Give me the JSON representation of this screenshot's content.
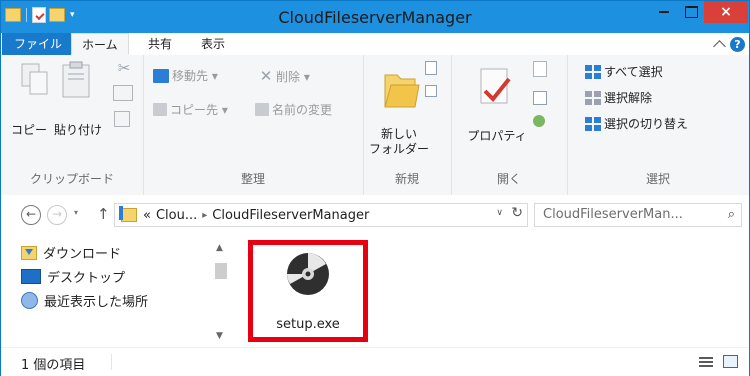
{
  "window": {
    "title": "CloudFileserverManager"
  },
  "titlebar": {
    "close": "×",
    "qat_dropdown": "▾"
  },
  "tabs": {
    "file": "ファイル",
    "home": "ホーム",
    "share": "共有",
    "view": "表示",
    "help": "?"
  },
  "ribbon": {
    "clipboard": {
      "copy": "コピー",
      "paste": "貼り付け",
      "label": "クリップボード"
    },
    "organize": {
      "move_to": "移動先 ▾",
      "delete": "削除 ▾",
      "copy_to": "コピー先 ▾",
      "rename": "名前の変更",
      "label": "整理"
    },
    "new": {
      "new_folder_line1": "新しい",
      "new_folder_line2": "フォルダー",
      "label": "新規"
    },
    "open": {
      "properties": "プロパティ",
      "label": "開く"
    },
    "select": {
      "select_all": "すべて選択",
      "select_none": "選択解除",
      "invert": "選択の切り替え",
      "label": "選択"
    }
  },
  "address": {
    "back": "←",
    "forward": "→",
    "recent_dropdown": "▾",
    "up": "↑",
    "overflow": "«",
    "crumb1": "Clou...",
    "crumb_sep": "▸",
    "crumb2": "CloudFileserverManager",
    "dropdown": "∨",
    "refresh": "↻",
    "search_placeholder": "CloudFileserverMan...",
    "search_icon": "⌕"
  },
  "navpane": {
    "items": [
      {
        "label": "ダウンロード",
        "icon": "downloads-icon"
      },
      {
        "label": "デスクトップ",
        "icon": "desktop-icon"
      },
      {
        "label": "最近表示した場所",
        "icon": "recent-places-icon"
      }
    ],
    "scroll_up": "▲",
    "scroll_down": "▼"
  },
  "files": [
    {
      "name": "setup.exe",
      "icon": "disc-installer-icon",
      "highlight_color": "#e60012"
    }
  ],
  "status": {
    "item_count": "1 個の項目"
  },
  "colors": {
    "titlebar": "#1e90e0",
    "file_tab": "#1979ca",
    "close": "#d9403a",
    "highlight": "#e60012"
  }
}
